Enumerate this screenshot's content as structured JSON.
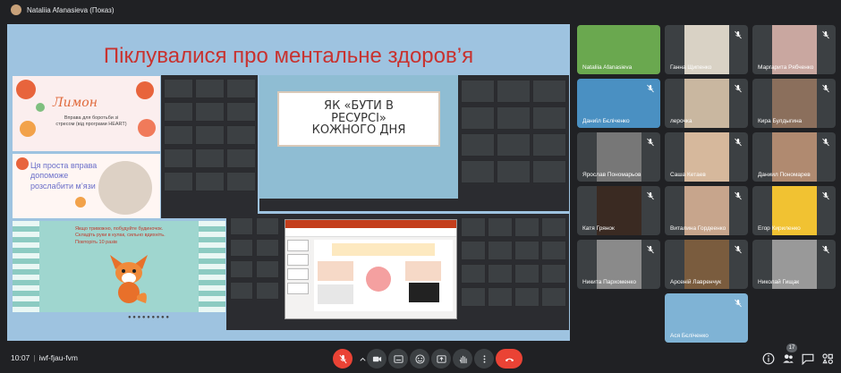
{
  "presenter": {
    "label": "Nataliia Afanasieva (Показ)"
  },
  "slide": {
    "title": "Піклувалися про ментальне здоров’я",
    "flower_card": {
      "brand": "Лимон",
      "heading": "Лимон",
      "sub": "Вправа для боротьби зі стресом (від програми HEART)"
    },
    "relax_card": {
      "text": "Ця проста вправа допоможе розслабити м’язи"
    },
    "fox_card": {
      "text": "Якщо тривожно, побудуйте будиночок. Складіть руки в кулак, сильно вдихніть. Повторіть 10 разів"
    },
    "center_slide": {
      "line1": "ЯК «БУТИ В",
      "line2": "РЕСУРСІ»",
      "line3": "КОЖНОГО ДНЯ"
    }
  },
  "participants": [
    {
      "name": "Nataliia Afanasieva",
      "color": "#6aa84f"
    },
    {
      "name": "Ганна Щипенко",
      "color": "#d9d2c5"
    },
    {
      "name": "Маргарита Рябченко",
      "color": "#c9a7a0"
    },
    {
      "name": "Даниїл Бєліченко",
      "color": "#4a90c2"
    },
    {
      "name": "лерочка",
      "color": "#c9b7a0"
    },
    {
      "name": "Кира Булдыгина",
      "color": "#8b6f5c"
    },
    {
      "name": "Ярослав Пономарьов",
      "color": "#777777"
    },
    {
      "name": "Саша Кетаев",
      "color": "#d6b89c"
    },
    {
      "name": "Даниил Пономарев",
      "color": "#b08a70"
    },
    {
      "name": "Катя Грянок",
      "color": "#3a2a22"
    },
    {
      "name": "Виталина Гордеенко",
      "color": "#c7a58c"
    },
    {
      "name": "Егор Кириленко",
      "color": "#f1c232"
    },
    {
      "name": "Никита Пархоменко",
      "color": "#8a8a8a"
    },
    {
      "name": "Арсеній Лавренчук",
      "color": "#7a5c3e"
    },
    {
      "name": "Николай Гищак",
      "color": "#999999"
    },
    {
      "name": "Ася Бєліченко",
      "color": "#7fb3d5"
    }
  ],
  "meeting": {
    "time": "10:07",
    "code": "iwf-fjau-fvm"
  },
  "participant_count": "17",
  "colors": {
    "background": "#202124",
    "accent_red": "#ea4335",
    "slide_title": "#c8322f"
  }
}
